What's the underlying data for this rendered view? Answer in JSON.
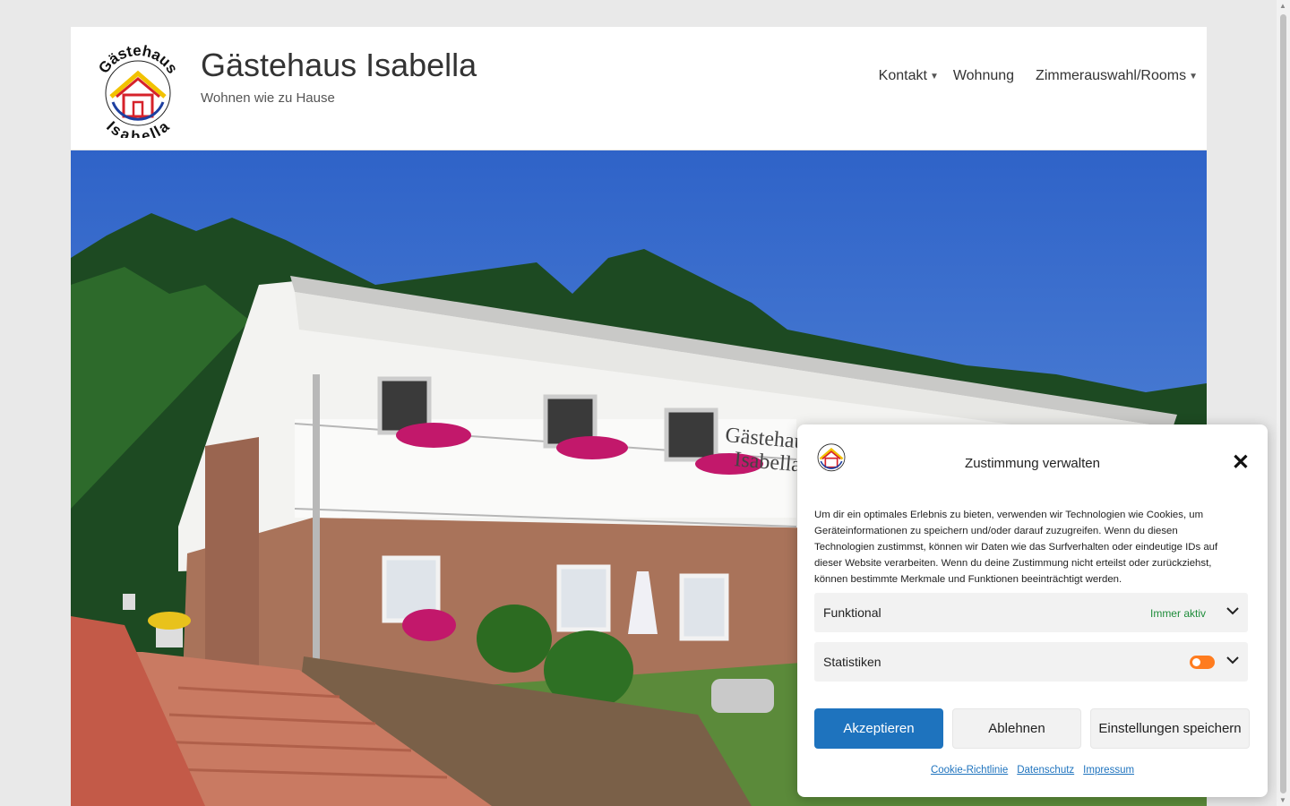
{
  "header": {
    "site_title": "Gästehaus Isabella",
    "site_description": "Wohnen wie zu Hause",
    "logo_text_top": "Gästehaus",
    "logo_text_bottom": "Isabella"
  },
  "nav": {
    "items": [
      {
        "label": "Kontakt",
        "has_dropdown": true
      },
      {
        "label": "Wohnung",
        "has_dropdown": false
      },
      {
        "label": "Zimmerauswahl/Rooms",
        "has_dropdown": true
      }
    ]
  },
  "hero": {
    "building_sign_line1": "Gästehaus",
    "building_sign_line2": "Isabella"
  },
  "consent": {
    "title": "Zustimmung verwalten",
    "close_icon": "close-icon",
    "text": "Um dir ein optimales Erlebnis zu bieten, verwenden wir Technologien wie Cookies, um Geräteinformationen zu speichern und/oder darauf zuzugreifen. Wenn du diesen Technologien zustimmst, können wir Daten wie das Surfverhalten oder eindeutige IDs auf dieser Website verarbeiten. Wenn du deine Zustimmung nicht erteilst oder zurückziehst, können bestimmte Merkmale und Funktionen beeinträchtigt werden.",
    "categories": [
      {
        "label": "Funktional",
        "status": "Immer aktiv"
      },
      {
        "label": "Statistiken",
        "toggle_on": true
      }
    ],
    "buttons": {
      "accept": "Akzeptieren",
      "deny": "Ablehnen",
      "save": "Einstellungen speichern"
    },
    "links": [
      "Cookie-Richtlinie",
      "Datenschutz",
      "Impressum"
    ]
  },
  "colors": {
    "accent": "#1e73be",
    "toggle": "#ff7c1f",
    "always_active": "#1e8c3a"
  }
}
